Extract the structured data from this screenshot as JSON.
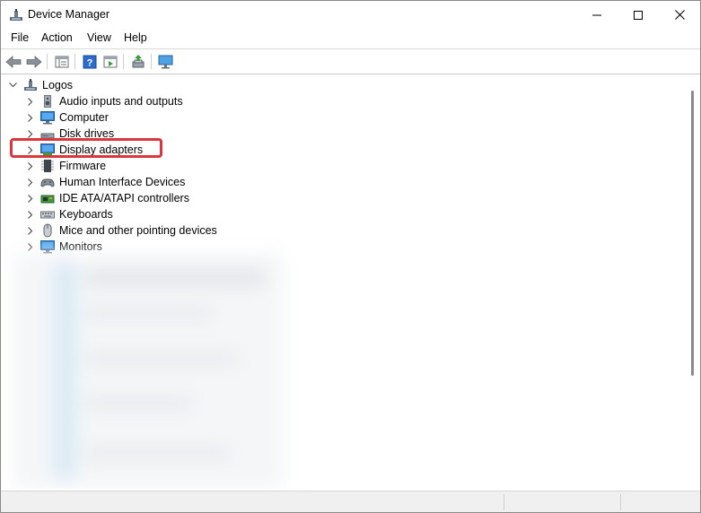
{
  "window": {
    "title": "Device Manager",
    "controls": {
      "minimize": "minimize",
      "maximize": "maximize",
      "close": "close"
    }
  },
  "menu": {
    "items": [
      "File",
      "Action",
      "View",
      "Help"
    ]
  },
  "toolbar": {
    "buttons": [
      {
        "icon": "back-arrow-icon"
      },
      {
        "icon": "forward-arrow-icon"
      },
      {
        "icon": "properties-panel-icon"
      },
      {
        "icon": "help-icon"
      },
      {
        "icon": "run-update-icon"
      },
      {
        "icon": "update-driver-icon"
      },
      {
        "icon": "scan-hardware-icon"
      }
    ]
  },
  "tree": {
    "root": {
      "label": "Logos",
      "expanded": true,
      "icon": "computer-tree-icon"
    },
    "items": [
      {
        "label": "Audio inputs and outputs",
        "icon": "speaker-icon"
      },
      {
        "label": "Computer",
        "icon": "monitor-icon"
      },
      {
        "label": "Disk drives",
        "icon": "disk-drive-icon"
      },
      {
        "label": "Display adapters",
        "icon": "display-adapter-icon",
        "highlighted": true
      },
      {
        "label": "Firmware",
        "icon": "chip-icon"
      },
      {
        "label": "Human Interface Devices",
        "icon": "hid-icon"
      },
      {
        "label": "IDE ATA/ATAPI controllers",
        "icon": "ide-controller-icon"
      },
      {
        "label": "Keyboards",
        "icon": "keyboard-icon"
      },
      {
        "label": "Mice and other pointing devices",
        "icon": "mouse-icon"
      },
      {
        "label": "Monitors",
        "icon": "monitor-icon"
      }
    ]
  },
  "colors": {
    "highlight_border": "#d9363e",
    "monitor_blue": "#2f7fd2",
    "scroll_thumb": "#8a8a8a"
  }
}
